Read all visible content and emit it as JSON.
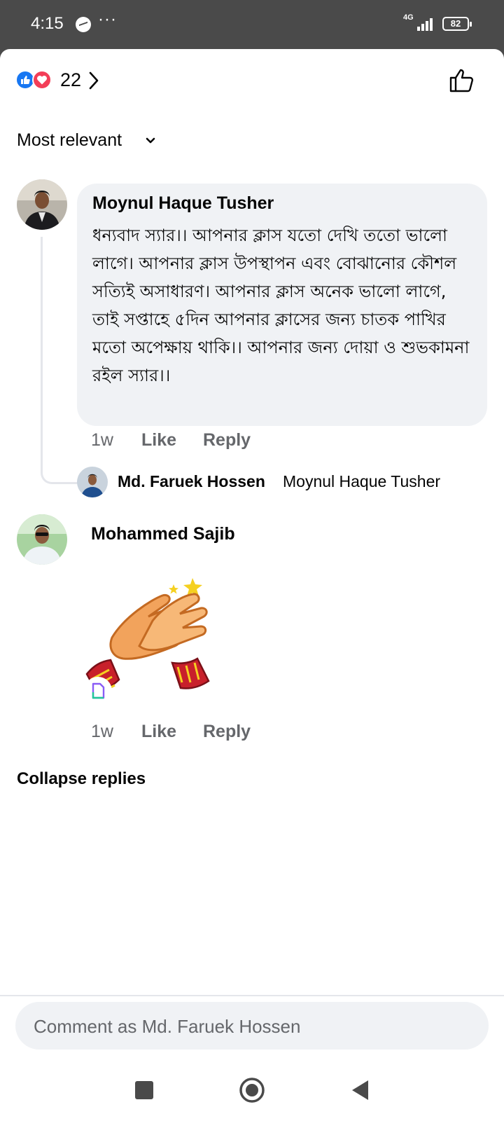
{
  "status_bar": {
    "time": "4:15",
    "dots": "···",
    "network": "4G",
    "battery": "82"
  },
  "reactions": {
    "count": "22",
    "icons": [
      "like-icon",
      "love-icon"
    ]
  },
  "sort": {
    "label": "Most relevant"
  },
  "comments": [
    {
      "author": "Moynul Haque Tusher",
      "text": "ধন্যবাদ স্যার।। আপনার ক্লাস যতো দেখি ততো ভালো লাগে। আপনার ক্লাস উপস্থাপন এবং বোঝানোর কৌশল সত্যিই অসাধারণ। আপনার ক্লাস অনেক ভালো লাগে, তাই সপ্তাহে ৫দিন আপনার ক্লাসের জন্য চাতক পাখির মতো অপেক্ষায় থাকি।। আপনার জন্য দোয়া ও শুভকামনা রইল স্যার।।",
      "time": "1w",
      "like": "Like",
      "reply": "Reply"
    },
    {
      "author": "Mohammed Sajib",
      "sticker": "clapping-hands-sticker",
      "time": "1w",
      "like": "Like",
      "reply": "Reply"
    }
  ],
  "reply_preview": {
    "author": "Md. Faruek Hossen",
    "text": "Moynul Haque Tusher"
  },
  "collapse_label": "Collapse replies",
  "composer": {
    "placeholder": "Comment as Md. Faruek Hossen"
  },
  "colors": {
    "like_blue": "#1877f2",
    "love_red": "#f33e58",
    "bubble_bg": "#f0f2f5",
    "secondary_text": "#65676b"
  }
}
